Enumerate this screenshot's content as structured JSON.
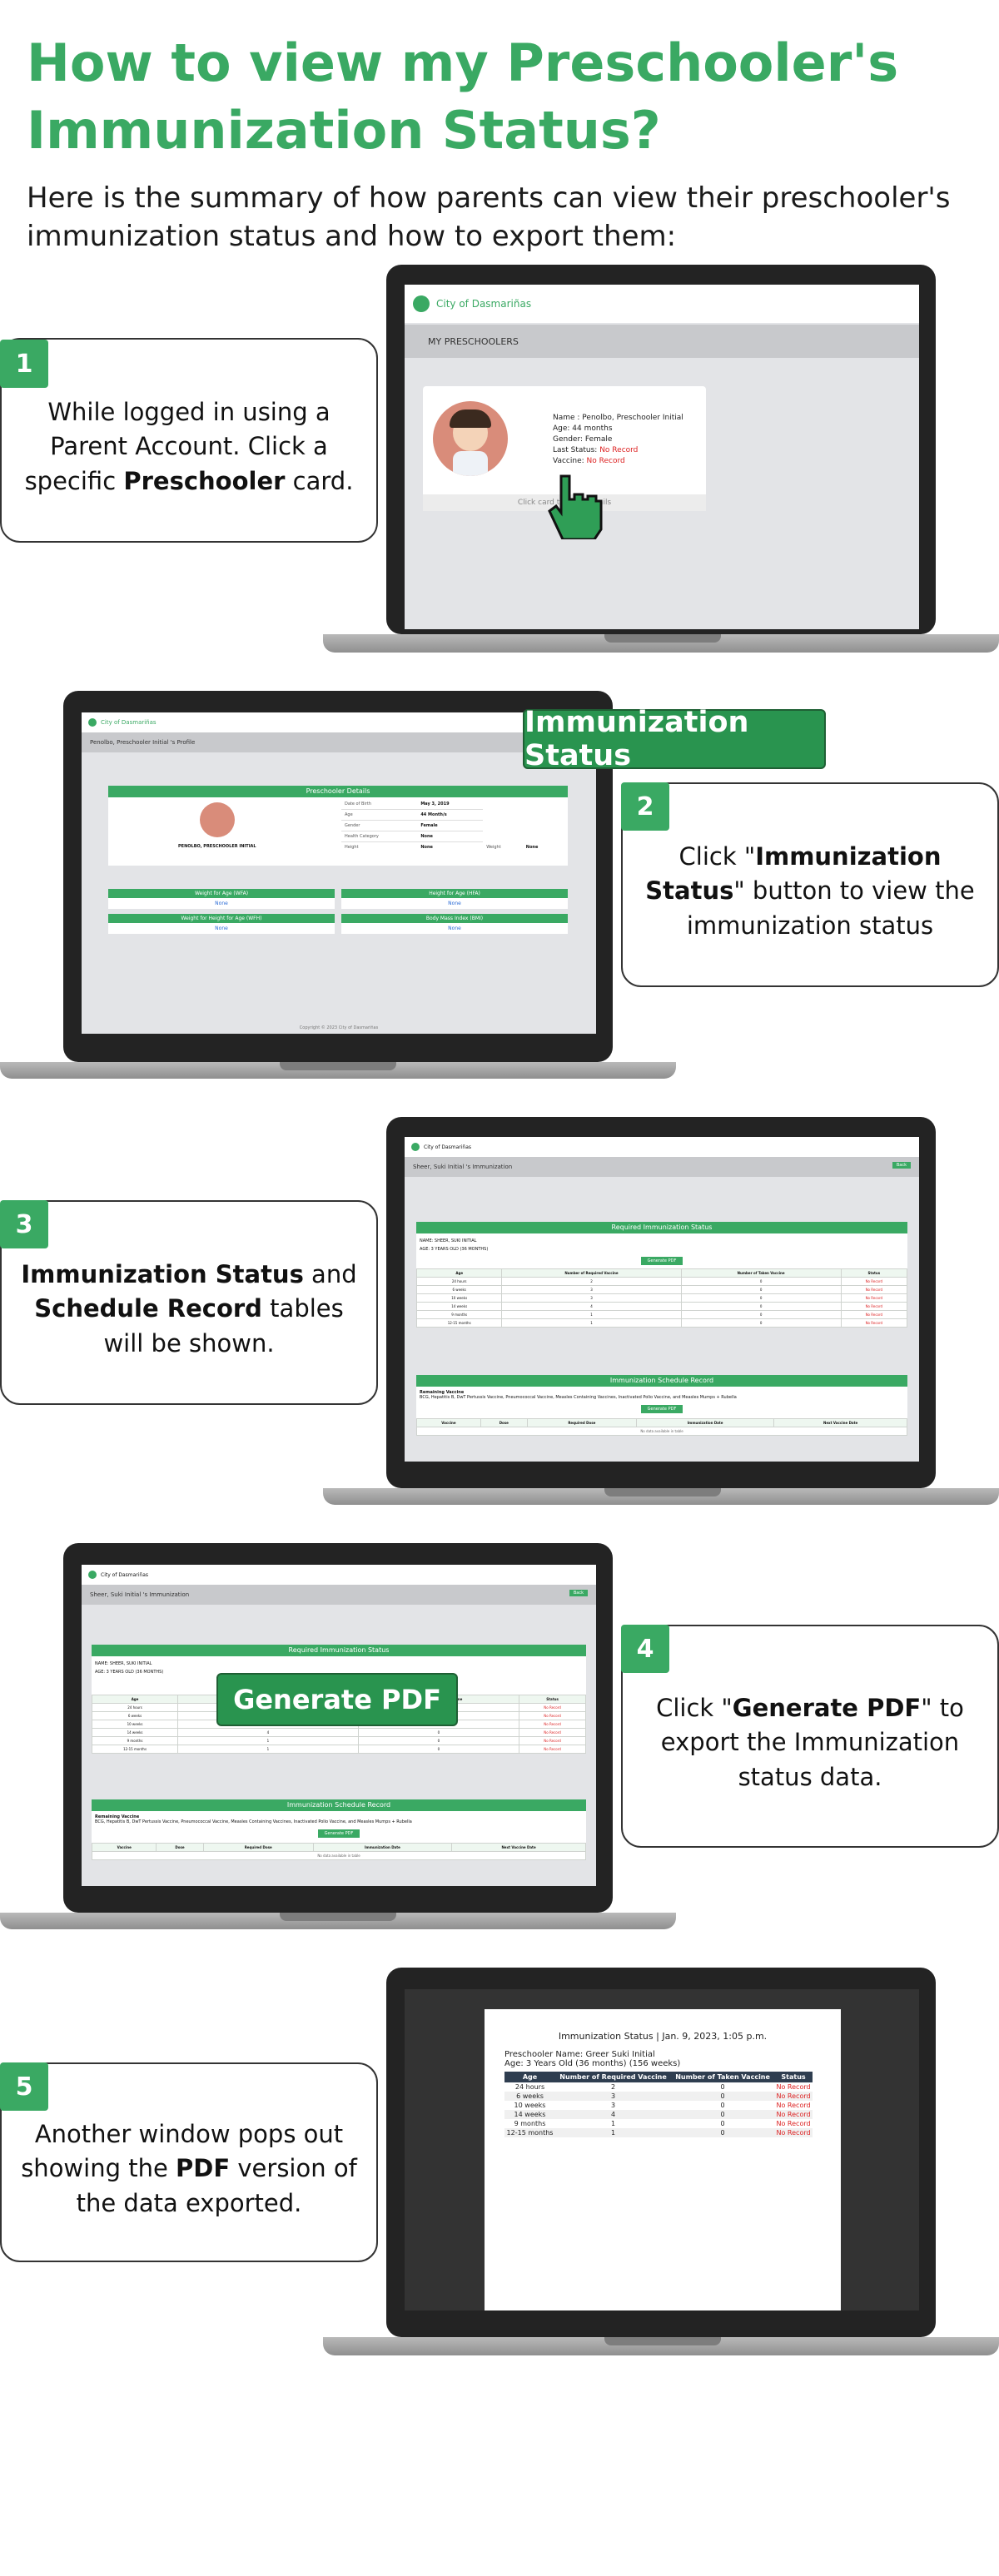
{
  "title": "How to view my Preschooler's Immunization Status?",
  "intro": "Here is the summary of how parents can view their preschooler's immunization status and how to export them:",
  "steps": [
    {
      "num": "1",
      "pre": "While logged in using a Parent Account. Click a specific ",
      "bold": "Preschooler",
      "post": " card."
    },
    {
      "num": "2",
      "pre": "Click \"",
      "bold": "Immunization Status",
      "post": "\" button to view the immunization status"
    },
    {
      "num": "3",
      "bold": "Immunization Status",
      "mid": " and ",
      "bold2": "Schedule Record",
      "post": " tables will be shown."
    },
    {
      "num": "4",
      "pre": "Click \"",
      "bold": "Generate PDF",
      "post": "\" to export the Immunization status data."
    },
    {
      "num": "5",
      "pre": "Another window pops out showing the ",
      "bold": "PDF",
      "post": " version of the data exported."
    }
  ],
  "callouts": {
    "immunization_status": "Immunization Status",
    "generate_pdf": "Generate PDF"
  },
  "screen1": {
    "app_name": "City of Dasmariñas",
    "section": "MY PRESCHOOLERS",
    "card": {
      "name": "Name : Penolbo, Preschooler Initial",
      "age": "Age: 44 months",
      "gender": "Gender: Female",
      "last_status_label": "Last Status:",
      "last_status": "No Record",
      "vaccine_label": "Vaccine:",
      "vaccine": "No Record",
      "footer": "Click card to view details"
    }
  },
  "screen2": {
    "app_name": "City of Dasmariñas",
    "breadcrumb": "Penolbo, Preschooler Initial 's Profile",
    "details_title": "Preschooler Details",
    "child_name": "PENOLBO, PRESCHOOLER INITIAL",
    "details": [
      [
        "Date of Birth",
        "May 3, 2019"
      ],
      [
        "Age",
        "44 Month/s"
      ],
      [
        "Gender",
        "Female"
      ],
      [
        "Health Category",
        "None"
      ]
    ],
    "height_label": "Height",
    "height_val": "None",
    "weight_label": "Weight",
    "weight_val": "None",
    "panels": [
      {
        "title": "Weight for Age (WFA)",
        "val": "None"
      },
      {
        "title": "Height for Age (HFA)",
        "val": "None"
      },
      {
        "title": "Weight for Height for Age (WFH)",
        "val": "None"
      },
      {
        "title": "Body Mass Index (BMI)",
        "val": "None"
      }
    ],
    "footer": "Copyright © 2023 City of Dasmariñas"
  },
  "screen3": {
    "app_name": "City of Dasmariñas",
    "breadcrumb": "Sheer, Suki Initial 's Immunization",
    "back_label": "Back",
    "table_title": "Required Immunization Status",
    "name_line": "NAME: SHEER, SUKI INITIAL",
    "age_line": "AGE: 3 YEARS OLD (36 MONTHS)",
    "gen_label": "Generate PDF",
    "columns": [
      "Age",
      "Number of Required Vaccine",
      "Number of Taken Vaccine",
      "Status"
    ],
    "rows": [
      [
        "24 hours",
        "2",
        "0",
        "No Record"
      ],
      [
        "6 weeks",
        "3",
        "0",
        "No Record"
      ],
      [
        "10 weeks",
        "3",
        "0",
        "No Record"
      ],
      [
        "14 weeks",
        "4",
        "0",
        "No Record"
      ],
      [
        "9 months",
        "1",
        "0",
        "No Record"
      ],
      [
        "12-15 months",
        "1",
        "0",
        "No Record"
      ]
    ],
    "schedule_title": "Immunization Schedule Record",
    "remaining_label": "Remaining Vaccine",
    "remaining_text": "BCG, Hepatitis B, DwT Pertussis Vaccine, Pneumococcal Vaccine, Measles Containing Vaccines, Inactivated Polio Vaccine, and Measles Mumps + Rubella",
    "sched_columns": [
      "Vaccine",
      "Dose",
      "Required Dose",
      "Immunization Date",
      "Next Vaccine Date"
    ],
    "no_data": "No data available in table"
  },
  "screen5": {
    "pdf_title": "Immunization Status | Jan. 9, 2023, 1:05 p.m.",
    "pdf_name": "Preschooler Name: Greer Suki  Initial",
    "pdf_age": "Age: 3 Years Old (36 months) (156 weeks)",
    "columns": [
      "Age",
      "Number of Required Vaccine",
      "Number of Taken Vaccine",
      "Status"
    ],
    "rows": [
      [
        "24 hours",
        "2",
        "0",
        "No Record"
      ],
      [
        "6 weeks",
        "3",
        "0",
        "No Record"
      ],
      [
        "10 weeks",
        "3",
        "0",
        "No Record"
      ],
      [
        "14 weeks",
        "4",
        "0",
        "No Record"
      ],
      [
        "9 months",
        "1",
        "0",
        "No Record"
      ],
      [
        "12-15 months",
        "1",
        "0",
        "No Record"
      ]
    ]
  },
  "colors": {
    "brand_green": "#3aa963",
    "callout_green": "#29944f",
    "status_red": "#dd2222"
  }
}
